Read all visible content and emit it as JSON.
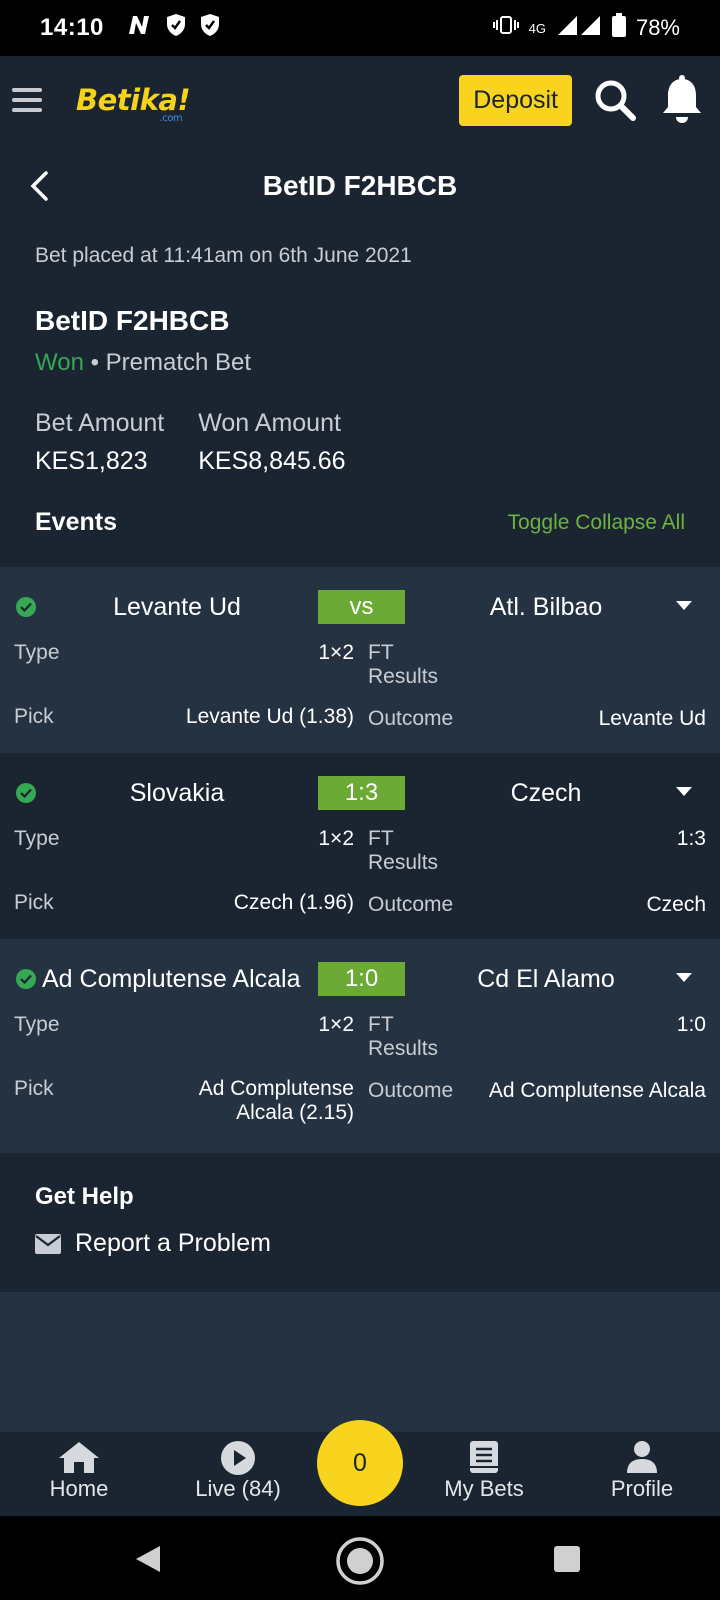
{
  "status_bar": {
    "time": "14:10",
    "network": "4G",
    "battery": "78%"
  },
  "header": {
    "logo": "Betika!",
    "logo_sub": ".com",
    "deposit_label": "Deposit"
  },
  "page": {
    "title": "BetID F2HBCB",
    "placed_text": "Bet placed at 11:41am on 6th June 2021",
    "bet_id": "BetID F2HBCB",
    "status": "Won",
    "bet_kind": "Prematch Bet",
    "bet_amount_label": "Bet Amount",
    "bet_amount": "KES1,823",
    "won_amount_label": "Won Amount",
    "won_amount": "KES8,845.66",
    "events_title": "Events",
    "toggle_label": "Toggle Collapse All"
  },
  "events": [
    {
      "home": "Levante Ud",
      "score": "vs",
      "away": "Atl. Bilbao",
      "type_label": "Type",
      "type": "1×2",
      "market": "FT Results",
      "result": "",
      "pick_label": "Pick",
      "pick": "Levante Ud (1.38)",
      "outcome_label": "Outcome",
      "outcome": "Levante Ud"
    },
    {
      "home": "Slovakia",
      "score": "1:3",
      "away": "Czech",
      "type_label": "Type",
      "type": "1×2",
      "market": "FT Results",
      "result": "1:3",
      "pick_label": "Pick",
      "pick": "Czech (1.96)",
      "outcome_label": "Outcome",
      "outcome": "Czech"
    },
    {
      "home": "Ad Complutense Alcala",
      "score": "1:0",
      "away": "Cd El Alamo",
      "type_label": "Type",
      "type": "1×2",
      "market": "FT Results",
      "result": "1:0",
      "pick_label": "Pick",
      "pick": "Ad Complutense Alcala (2.15)",
      "outcome_label": "Outcome",
      "outcome": "Ad Complutense Alcala"
    }
  ],
  "help": {
    "title": "Get Help",
    "report_label": "Report a Problem"
  },
  "bottom_nav": {
    "home": "Home",
    "live": "Live (84)",
    "betslip_count": "0",
    "my_bets": "My Bets",
    "profile": "Profile"
  }
}
